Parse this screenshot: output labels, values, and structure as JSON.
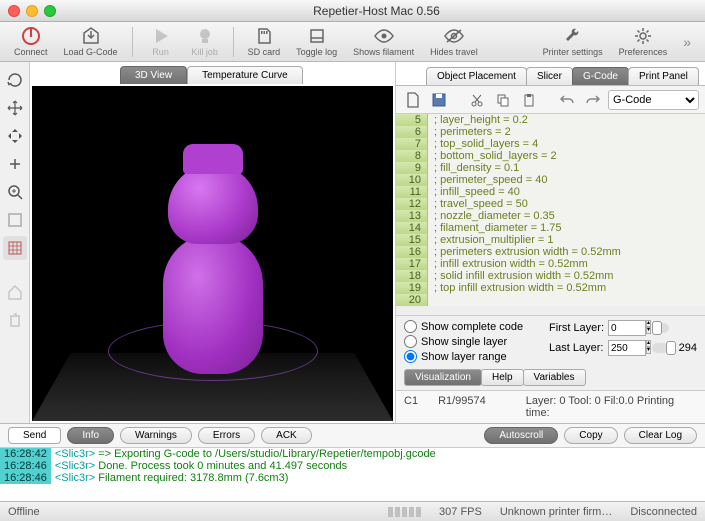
{
  "window": {
    "title": "Repetier-Host Mac 0.56"
  },
  "toolbar": {
    "connect": "Connect",
    "load": "Load G-Code",
    "run": "Run",
    "kill": "Kill job",
    "sd": "SD card",
    "toggle": "Toggle log",
    "filament": "Shows filament",
    "travel": "Hides travel",
    "printer": "Printer settings",
    "prefs": "Preferences"
  },
  "viewtabs": {
    "view3d": "3D View",
    "temp": "Temperature Curve"
  },
  "righttabs": {
    "placement": "Object Placement",
    "slicer": "Slicer",
    "gcode": "G-Code",
    "panel": "Print Panel"
  },
  "editor": {
    "dropdown": "G-Code"
  },
  "code_lines": [
    {
      "n": "5",
      "t": "; layer_height = 0.2"
    },
    {
      "n": "6",
      "t": "; perimeters = 2"
    },
    {
      "n": "7",
      "t": "; top_solid_layers = 4"
    },
    {
      "n": "8",
      "t": "; bottom_solid_layers = 2"
    },
    {
      "n": "9",
      "t": "; fill_density = 0.1"
    },
    {
      "n": "10",
      "t": "; perimeter_speed = 40"
    },
    {
      "n": "11",
      "t": "; infill_speed = 40"
    },
    {
      "n": "12",
      "t": "; travel_speed = 50"
    },
    {
      "n": "13",
      "t": "; nozzle_diameter = 0.35"
    },
    {
      "n": "14",
      "t": "; filament_diameter = 1.75"
    },
    {
      "n": "15",
      "t": "; extrusion_multiplier = 1"
    },
    {
      "n": "16",
      "t": "; perimeters extrusion width = 0.52mm"
    },
    {
      "n": "17",
      "t": "; infill extrusion width = 0.52mm"
    },
    {
      "n": "18",
      "t": "; solid infill extrusion width = 0.52mm"
    },
    {
      "n": "19",
      "t": "; top infill extrusion width = 0.52mm"
    },
    {
      "n": "20",
      "t": ""
    }
  ],
  "layerctl": {
    "complete": "Show complete code",
    "single": "Show single layer",
    "range": "Show layer range",
    "first_lbl": "First Layer:",
    "first": "0",
    "last_lbl": "Last Layer:",
    "last": "250",
    "max": "294"
  },
  "subtabs": {
    "viz": "Visualization",
    "help": "Help",
    "vars": "Variables"
  },
  "status": {
    "col": "C1",
    "row": "R1/99574",
    "layer": "Layer: 0 Tool: 0 Fil:0.0 Printing time:"
  },
  "logtabs": {
    "send": "Send",
    "info": "Info",
    "warn": "Warnings",
    "err": "Errors",
    "ack": "ACK",
    "auto": "Autoscroll",
    "copy": "Copy",
    "clear": "Clear Log"
  },
  "log": [
    {
      "t": "16:28:42",
      "tag": "<Slic3r>",
      "m": " => Exporting G-code to /Users/studio/Library/Repetier/tempobj.gcode"
    },
    {
      "t": "16:28:46",
      "tag": "<Slic3r>",
      "m": " Done. Process took 0 minutes and 41.497 seconds"
    },
    {
      "t": "16:28:46",
      "tag": "<Slic3r>",
      "m": " Filament required: 3178.8mm (7.6cm3)"
    }
  ],
  "footer": {
    "offline": "Offline",
    "fps": "307 FPS",
    "firm": "Unknown printer firm…",
    "disc": "Disconnected"
  }
}
